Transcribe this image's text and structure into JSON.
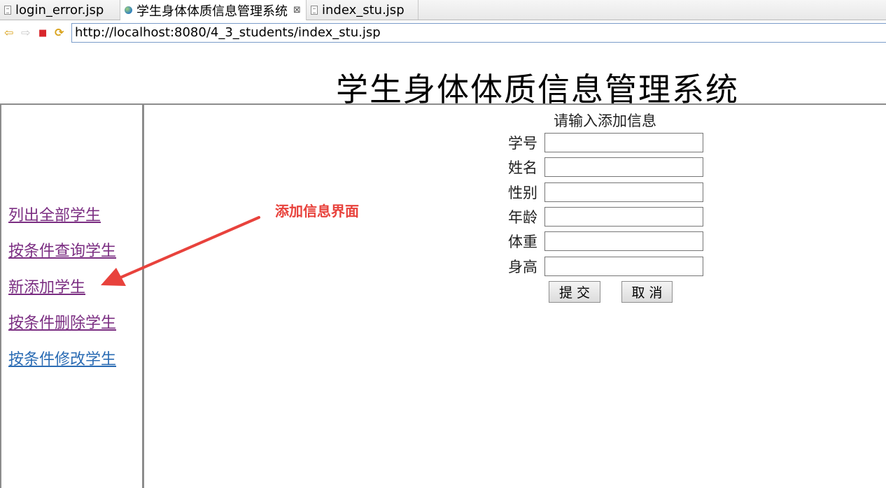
{
  "tabs": [
    {
      "label": "login_error.jsp",
      "icon": "jsp-file-icon"
    },
    {
      "label": "学生身体体质信息管理系统",
      "icon": "globe-icon",
      "close": "⊠"
    },
    {
      "label": "index_stu.jsp",
      "icon": "jsp-file-icon"
    }
  ],
  "toolbar": {
    "back_glyph": "⇦",
    "forward_glyph": "⇨",
    "stop_glyph": "■",
    "refresh_glyph": "⟳",
    "url": "http://localhost:8080/4_3_students/index_stu.jsp"
  },
  "page": {
    "title": "学生身体体质信息管理系统"
  },
  "sidebar": {
    "links": [
      {
        "label": "列出全部学生",
        "state": "visited"
      },
      {
        "label": "按条件查询学生",
        "state": "visited"
      },
      {
        "label": "新添加学生",
        "state": "visited"
      },
      {
        "label": "按条件删除学生",
        "state": "visited"
      },
      {
        "label": "按条件修改学生",
        "state": "link"
      }
    ]
  },
  "annotation": {
    "text": "添加信息界面",
    "color": "#e8423c"
  },
  "form": {
    "title": "请输入添加信息",
    "fields": [
      {
        "label": "学号",
        "value": ""
      },
      {
        "label": "姓名",
        "value": ""
      },
      {
        "label": "性别",
        "value": ""
      },
      {
        "label": "年龄",
        "value": ""
      },
      {
        "label": "体重",
        "value": ""
      },
      {
        "label": "身高",
        "value": ""
      }
    ],
    "submit_label": "提交",
    "cancel_label": "取消"
  },
  "colors": {
    "visited_link": "#7b2e82",
    "link": "#2b6cb4",
    "annotation": "#e8423c"
  }
}
